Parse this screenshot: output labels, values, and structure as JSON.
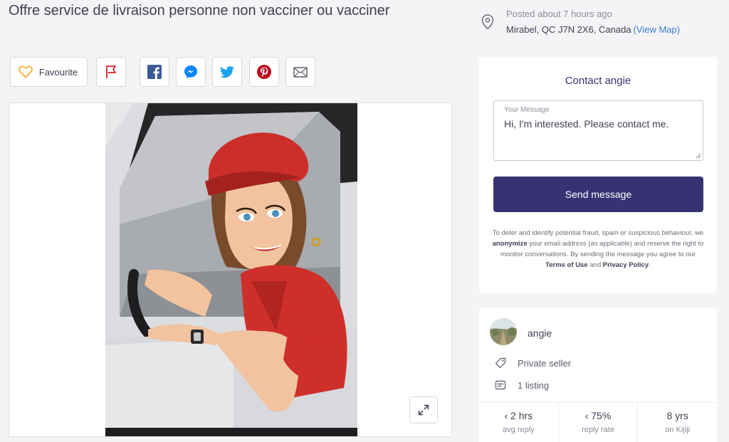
{
  "listing": {
    "title": "Offre service de livraison personne non vacciner ou vacciner",
    "posted": "Posted about 7 hours ago",
    "address": "Mirabel, QC J7N 2X6, Canada",
    "view_map": "(View Map)"
  },
  "actions": {
    "favourite_label": "Favourite",
    "icons": [
      "heart-icon",
      "flag-icon",
      "facebook-icon",
      "messenger-icon",
      "twitter-icon",
      "pinterest-icon",
      "email-icon"
    ]
  },
  "contact": {
    "title": "Contact angie",
    "message_label": "Your Message",
    "message_value": "Hi, I'm interested. Please contact me.",
    "send_label": "Send message",
    "disclaimer": {
      "part1": "To deter and identify potential fraud, spam or suspicious behaviour, we ",
      "anonymize": "anonymize",
      "part2": " your email address (as applicable) and reserve the right to monitor conversations. By sending the message you agree to our ",
      "terms": "Terms of Use",
      "and": " and ",
      "privacy": "Privacy Policy",
      "end": "."
    }
  },
  "seller": {
    "name": "angie",
    "type": "Private seller",
    "listings": "1 listing",
    "stats": [
      {
        "value": "‹ 2 hrs",
        "label": "avg reply"
      },
      {
        "value": "‹ 75%",
        "label": "reply rate"
      },
      {
        "value": "8 yrs",
        "label": "on Kijiji"
      }
    ]
  },
  "colors": {
    "brand": "#373373",
    "link": "#3a7bd5",
    "facebook": "#3b5998",
    "messenger": "#0084ff",
    "twitter": "#1da1f2",
    "pinterest": "#bd081c",
    "flag": "#e0242b",
    "heart": "#f5a623"
  }
}
